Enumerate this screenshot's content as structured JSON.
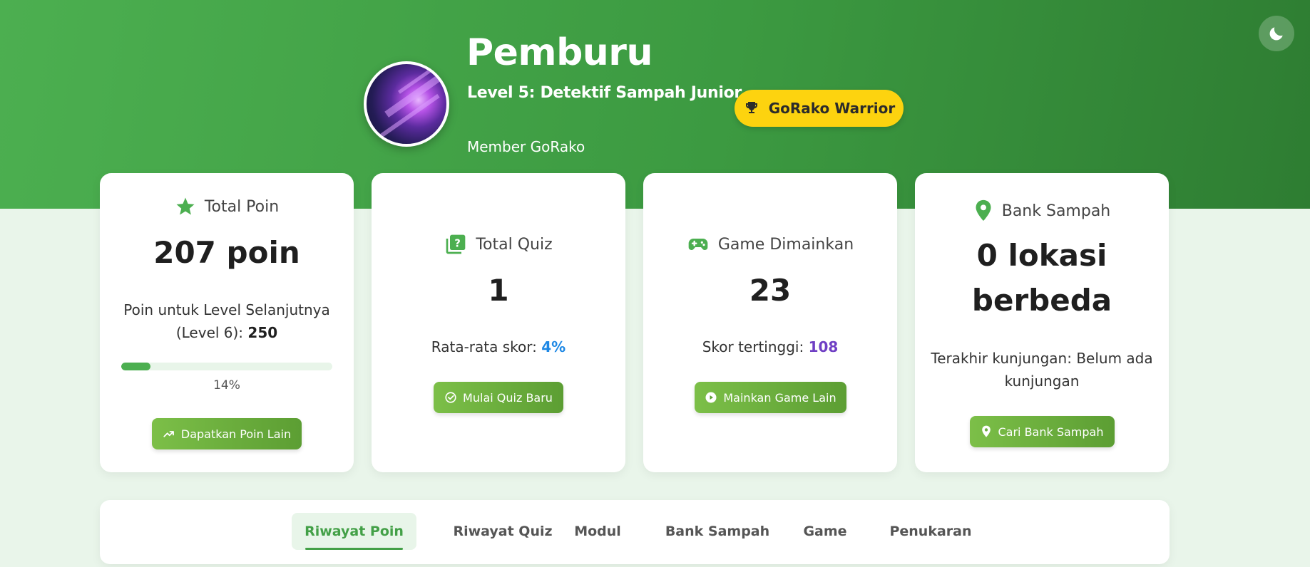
{
  "profile": {
    "name": "Pemburu",
    "level": "Level 5: Detektif Sampah Junior",
    "badge": "GoRako Warrior",
    "member": "Member GoRako"
  },
  "theme_toggle": {
    "icon": "moon-icon"
  },
  "cards": {
    "points": {
      "title": "Total Poin",
      "icon": "star-icon",
      "value": "207 poin",
      "next_level_text": "Poin untuk Level Selanjutnya (Level 6):",
      "next_level_points": "250",
      "progress_percent": 14,
      "progress_label": "14%",
      "button": "Dapatkan Poin Lain",
      "button_icon": "trending-up-icon"
    },
    "quiz": {
      "title": "Total Quiz",
      "icon": "quiz-icon",
      "value": "1",
      "avg_label": "Rata-rata skor:",
      "avg_value": "4%",
      "button": "Mulai Quiz Baru",
      "button_icon": "check-circle-icon"
    },
    "games": {
      "title": "Game Dimainkan",
      "icon": "gamepad-icon",
      "value": "23",
      "best_label": "Skor tertinggi:",
      "best_value": "108",
      "button": "Mainkan Game Lain",
      "button_icon": "play-circle-icon"
    },
    "bank": {
      "title": "Bank Sampah",
      "icon": "map-pin-icon",
      "value_line1": "0 lokasi",
      "value_line2": "berbeda",
      "last_visit": "Terakhir kunjungan: Belum ada kunjungan",
      "button": "Cari Bank Sampah",
      "button_icon": "map-pin-icon"
    }
  },
  "tabs": [
    {
      "label": "Riwayat Poin",
      "active": true
    },
    {
      "label": "Riwayat Quiz",
      "active": false
    },
    {
      "label": "Modul",
      "active": false
    },
    {
      "label": "Bank Sampah",
      "active": false
    },
    {
      "label": "Game",
      "active": false
    },
    {
      "label": "Penukaran",
      "active": false
    }
  ],
  "colors": {
    "primary_green": "#4caf50",
    "dark_green": "#2e7d32",
    "badge_yellow": "#fdd30f",
    "page_bg": "#e9f5ea",
    "accent_blue": "#1e88e5",
    "accent_purple": "#6f3fc4"
  }
}
